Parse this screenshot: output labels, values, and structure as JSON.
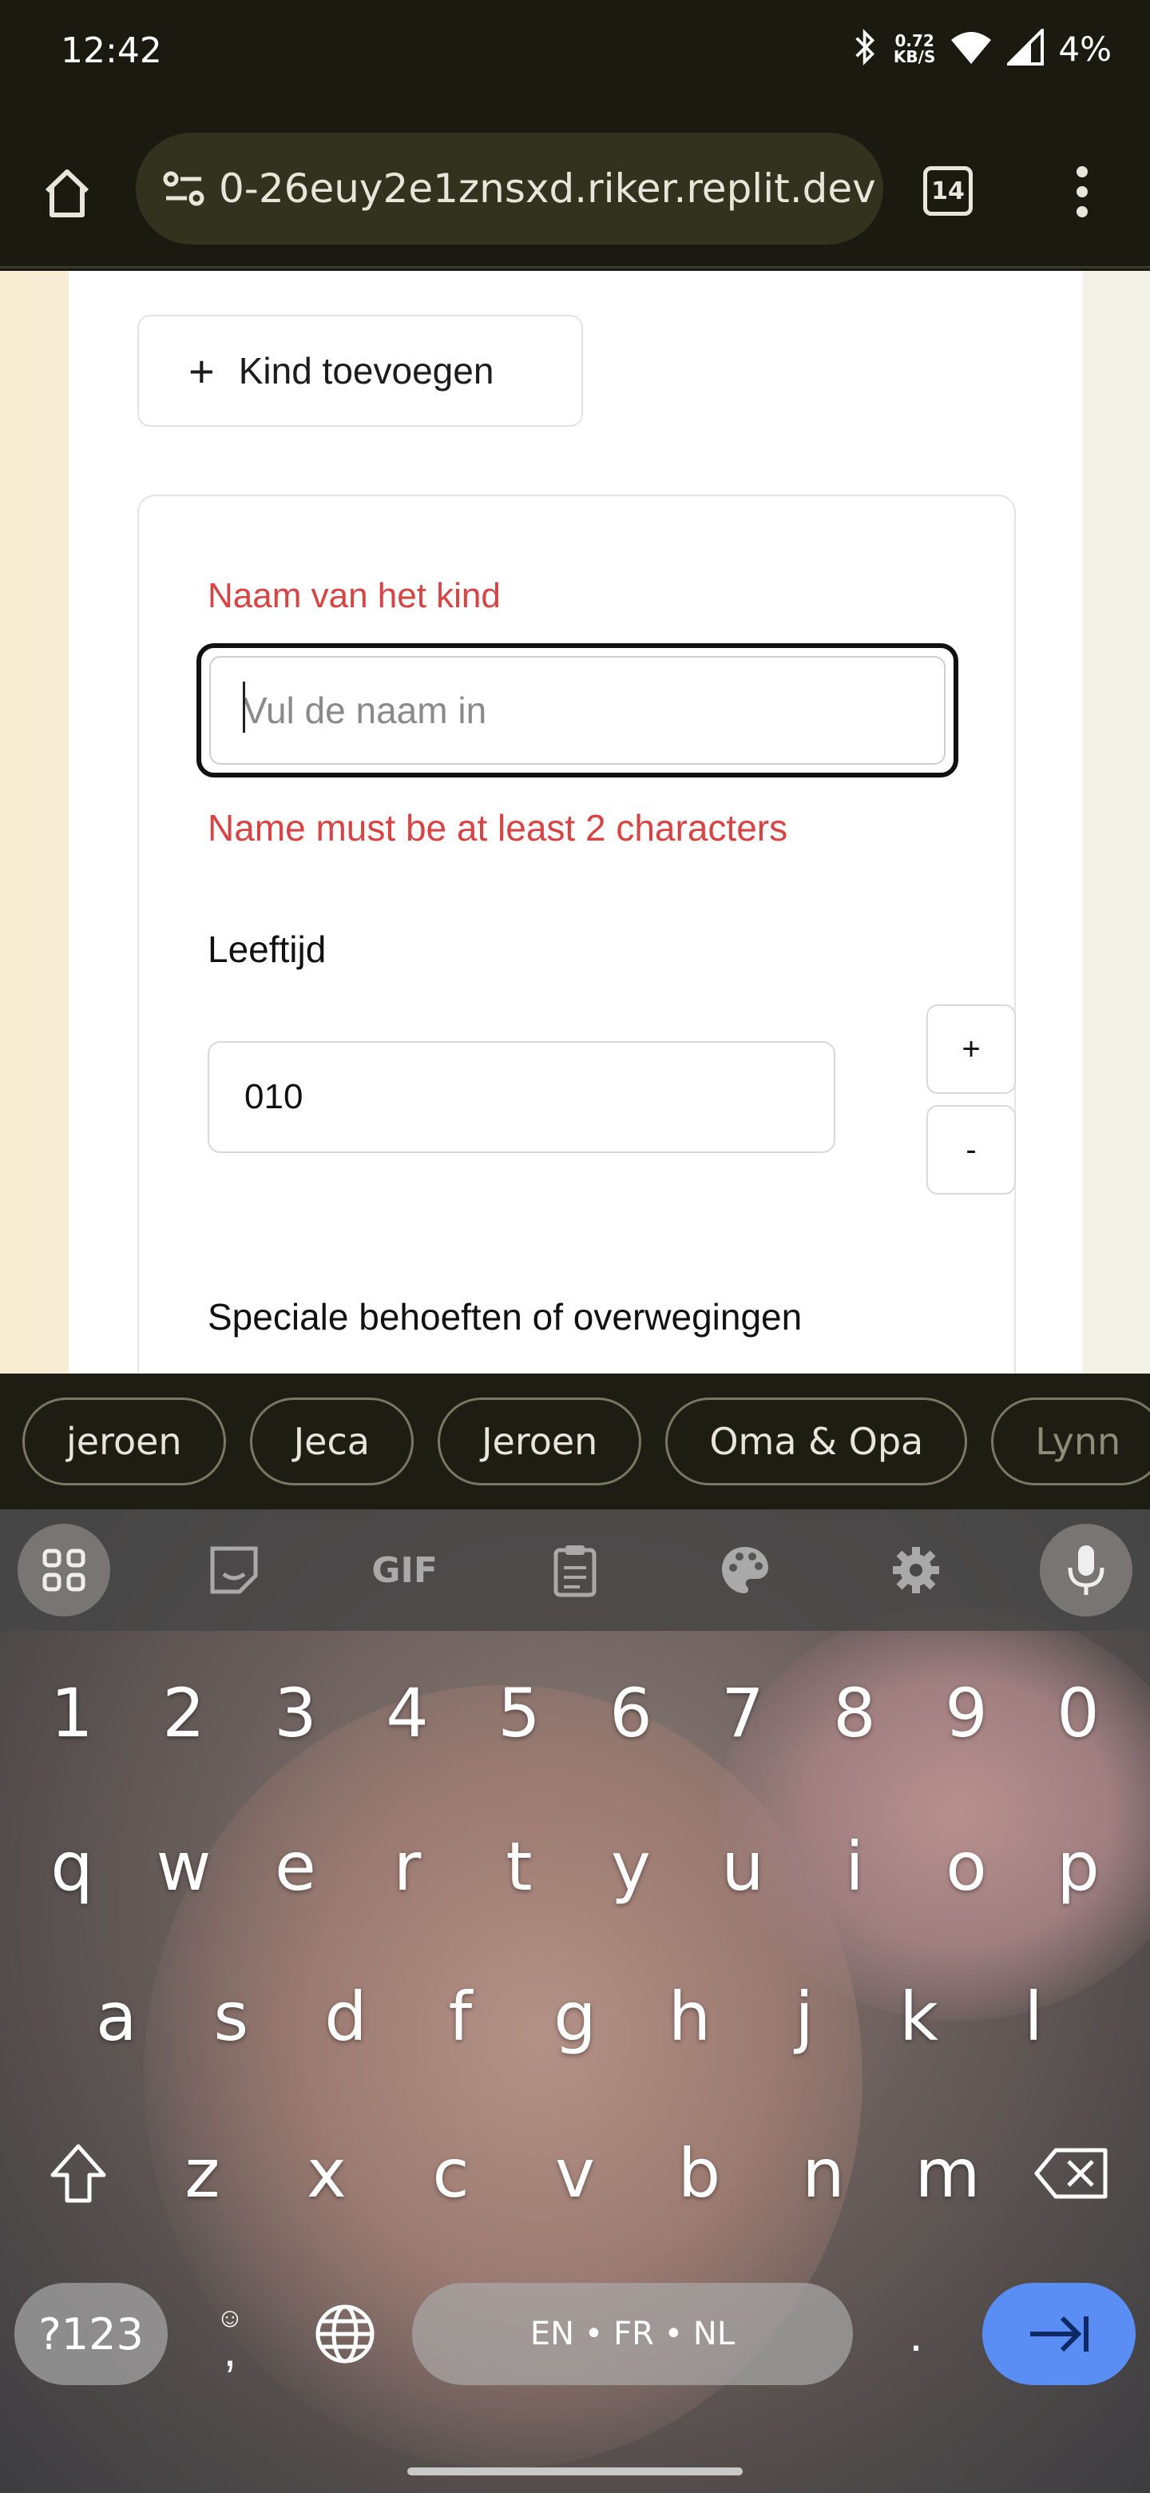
{
  "status_bar": {
    "time": "12:42",
    "net_speed_value": "0.72",
    "net_speed_unit": "KB/S",
    "battery": "4%"
  },
  "browser": {
    "url": "0-26euy2e1znsxd.riker.replit.dev",
    "tab_count": "14"
  },
  "page": {
    "add_child_label": "Kind toevoegen",
    "name_label": "Naam van het kind",
    "name_placeholder": "Vul de naam in",
    "name_error": "Name must be at least 2 characters",
    "age_label": "Leeftijd",
    "age_value": "010",
    "age_increment": "+",
    "age_decrement": "-",
    "special_label": "Speciale behoeften of overwegingen"
  },
  "suggestions": [
    "jeroen",
    "Jeca",
    "Jeroen",
    "Oma & Opa",
    "Lynn"
  ],
  "keyboard": {
    "toolbar_gif": "GIF",
    "row_numbers": [
      "1",
      "2",
      "3",
      "4",
      "5",
      "6",
      "7",
      "8",
      "9",
      "0"
    ],
    "row_1": [
      "q",
      "w",
      "e",
      "r",
      "t",
      "y",
      "u",
      "i",
      "o",
      "p"
    ],
    "row_2": [
      "a",
      "s",
      "d",
      "f",
      "g",
      "h",
      "j",
      "k",
      "l"
    ],
    "row_3": [
      "z",
      "x",
      "c",
      "v",
      "b",
      "n",
      "m"
    ],
    "symbols_key": "?123",
    "comma_key": ",",
    "space_label": "EN • FR • NL",
    "period_key": "."
  },
  "colors": {
    "error_red": "#d84343",
    "primary_green": "#1f5a47",
    "enter_blue": "#5b8ef5",
    "browser_bar": "#1b1a10"
  }
}
